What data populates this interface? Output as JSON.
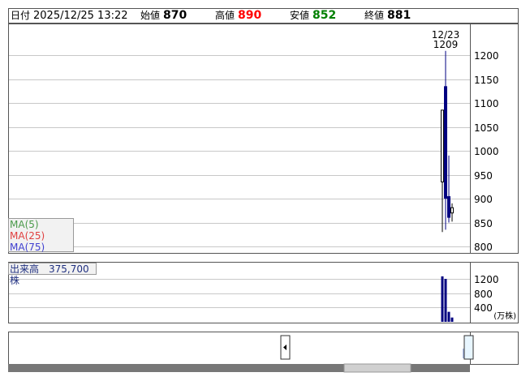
{
  "header": {
    "date_label": "日付",
    "datetime": "2025/12/25 13:22",
    "open_label": "始値",
    "open_value": "870",
    "high_label": "高値",
    "high_value": "890",
    "low_label": "安値",
    "low_value": "852",
    "close_label": "終値",
    "close_value": "881"
  },
  "legend": {
    "ma5": "MA(5)",
    "ma25": "MA(25)",
    "ma75": "MA(75)",
    "volume": "出来高　375,700株"
  },
  "colors": {
    "up": "#000000",
    "down": "#000080",
    "ma5": "#008000",
    "ma25": "#ff0000",
    "ma75": "#0000ff",
    "high_value": "#ff0000",
    "low_value": "#008000"
  },
  "chart_data": [
    {
      "type": "candlestick",
      "title": "",
      "y_ticks": [
        1200,
        1150,
        1100,
        1050,
        1000,
        950,
        900,
        850,
        800
      ],
      "ylim": [
        790,
        1210
      ],
      "annotation": {
        "date": "12/23",
        "value": "1209"
      },
      "candles": [
        {
          "open": 935,
          "high": 1085,
          "low": 830,
          "close": 1085,
          "dir": "up"
        },
        {
          "open": 1135,
          "high": 1209,
          "low": 835,
          "close": 900,
          "dir": "down"
        },
        {
          "open": 905,
          "high": 990,
          "low": 850,
          "close": 860,
          "dir": "down"
        },
        {
          "open": 870,
          "high": 890,
          "low": 852,
          "close": 881,
          "dir": "up"
        }
      ],
      "grid": true
    },
    {
      "type": "bar",
      "title": "出来高",
      "unit": "(万株)",
      "y_ticks": [
        1200,
        800,
        400
      ],
      "ylim": [
        0,
        1300
      ],
      "values": [
        1270,
        1200,
        280,
        120
      ],
      "grid": true
    }
  ]
}
